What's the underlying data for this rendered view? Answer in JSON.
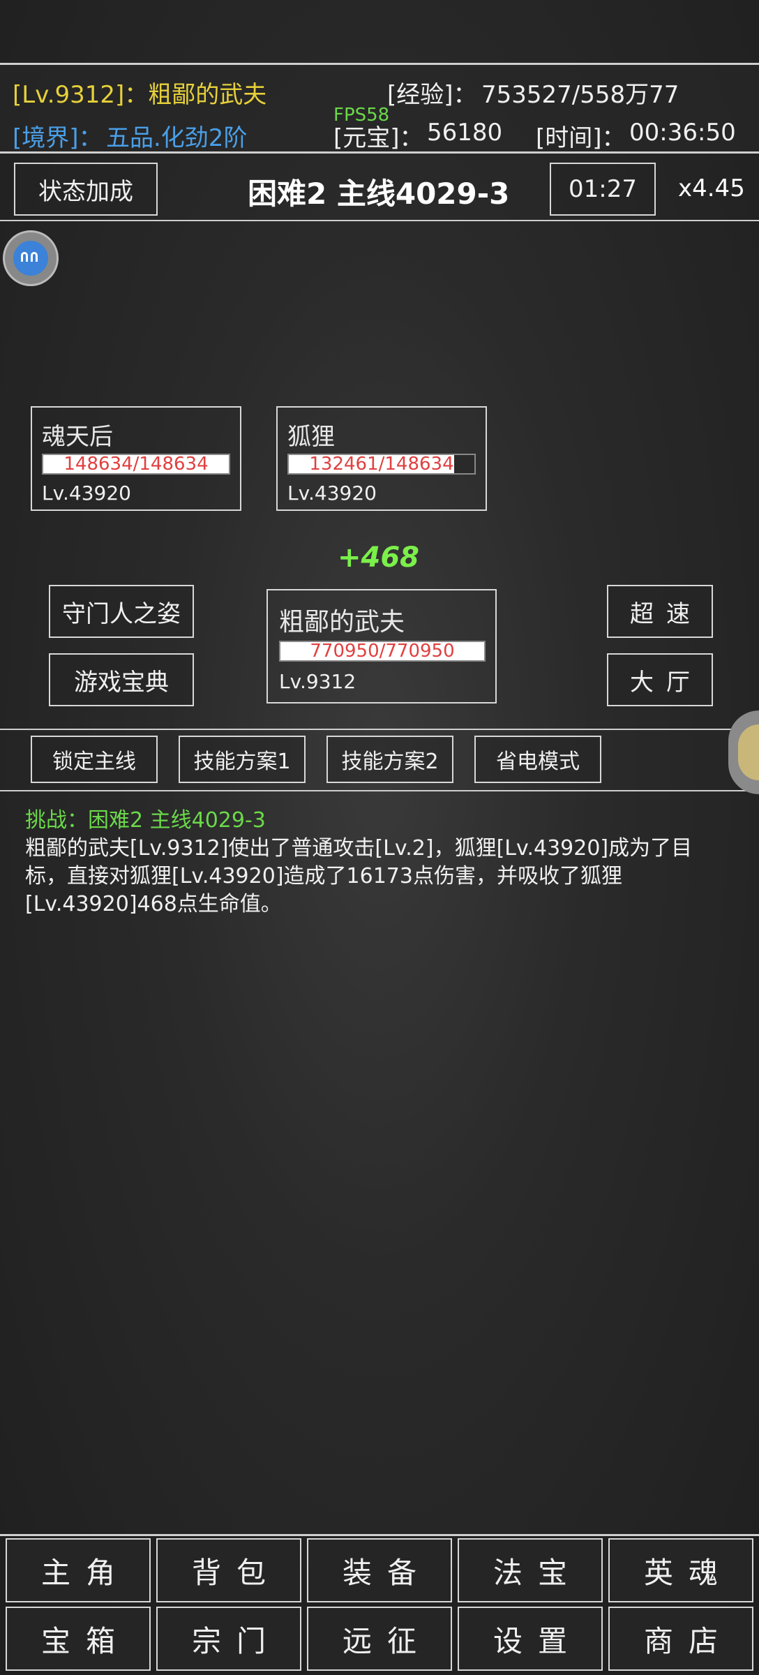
{
  "header": {
    "level_text": "[Lv.9312]：粗鄙的武夫",
    "exp_label": "[经验]：",
    "exp_value": "753527/558万77",
    "realm_label": "[境界]：",
    "realm_value": "五品.化劲2阶",
    "fps": "FPS58",
    "yuanbao_label": "[元宝]：",
    "yuanbao_value": "56180",
    "time_label": "[时间]：",
    "time_value": "00:36:50"
  },
  "stage_bar": {
    "status_button": "状态加成",
    "stage_title": "困难2 主线4029-3",
    "timer": "01:27",
    "speed": "x4.45"
  },
  "enemies": [
    {
      "name": "魂天后",
      "hp": "148634/148634",
      "hp_fraction": 1.0,
      "level": "Lv.43920"
    },
    {
      "name": "狐狸",
      "hp": "132461/148634",
      "hp_fraction": 0.891,
      "level": "Lv.43920"
    }
  ],
  "heal_popup": "+468",
  "player": {
    "name": "粗鄙的武夫",
    "hp": "770950/770950",
    "hp_fraction": 1.0,
    "level": "Lv.9312"
  },
  "side_buttons": {
    "gatekeeper": "守门人之姿",
    "handbook": "游戏宝典",
    "turbo": "超速",
    "lobby": "大厅"
  },
  "tabs": [
    "锁定主线",
    "技能方案1",
    "技能方案2",
    "省电模式"
  ],
  "log": {
    "challenge_label": "挑战：",
    "challenge_value": "困难2 主线4029-3",
    "message": "粗鄙的武夫[Lv.9312]使出了普通攻击[Lv.2]，狐狸[Lv.43920]成为了目标，直接对狐狸[Lv.43920]造成了16173点伤害，并吸收了狐狸[Lv.43920]468点生命值。"
  },
  "nav": {
    "row1": [
      "主角",
      "背包",
      "装备",
      "法宝",
      "英魂"
    ],
    "row2": [
      "宝箱",
      "宗门",
      "远征",
      "设置",
      "商店"
    ]
  },
  "colors": {
    "level": "#e6d03a",
    "realm": "#4a9fe8",
    "challenge": "#6bd94a",
    "hp_text": "#e04040"
  }
}
